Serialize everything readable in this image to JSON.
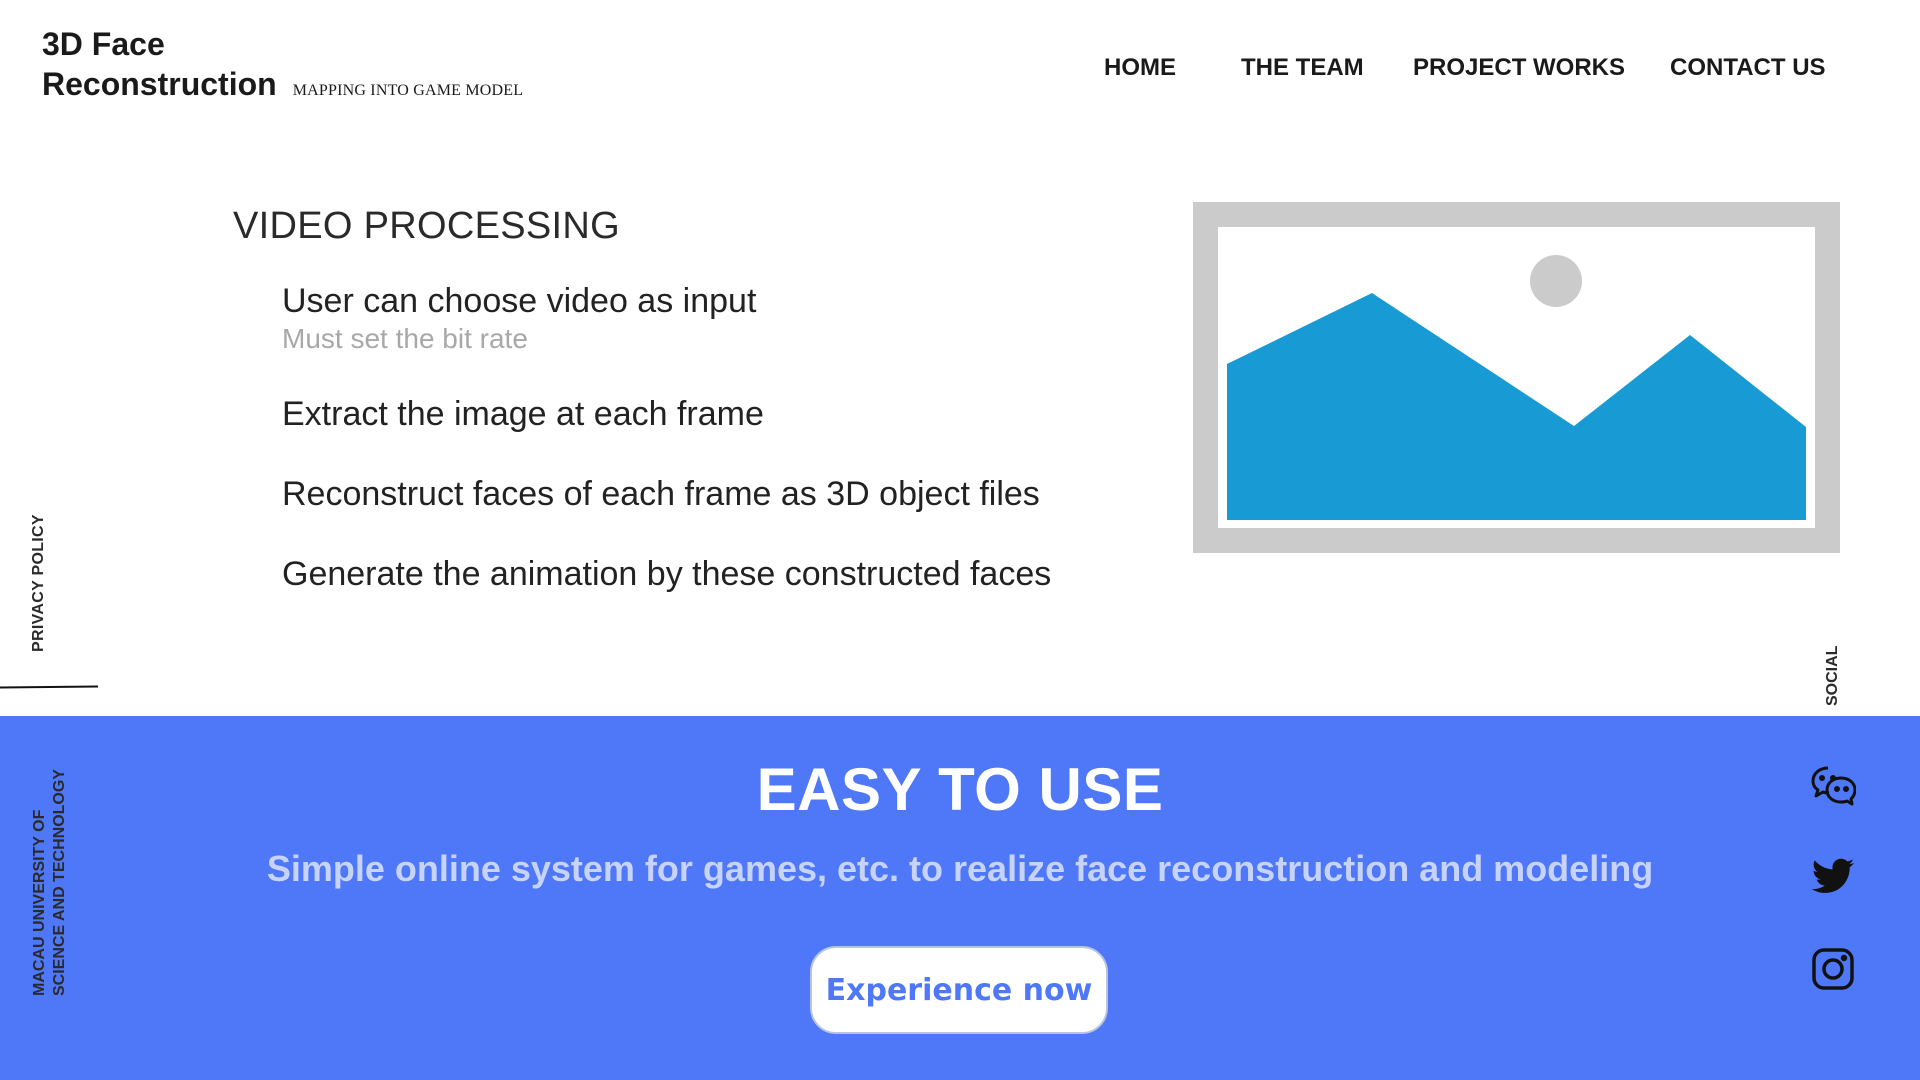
{
  "header": {
    "brand_line1": "3D Face",
    "brand_line2": "Reconstruction",
    "tagline": "MAPPING INTO GAME MODEL"
  },
  "nav": {
    "items": [
      {
        "label": "HOME"
      },
      {
        "label": "THE TEAM"
      },
      {
        "label": "PROJECT WORKS"
      },
      {
        "label": "CONTACT US"
      }
    ]
  },
  "main": {
    "section_title": "VIDEO PROCESSING",
    "items": [
      {
        "text": "User can choose video as input",
        "note": "Must set the bit rate"
      },
      {
        "text": "Extract the image at each frame"
      },
      {
        "text": "Reconstruct faces of each frame as 3D object files"
      },
      {
        "text": "Generate the animation by these constructed faces"
      }
    ],
    "image_icon": "image-placeholder-icon"
  },
  "side": {
    "privacy": "PRIVACY POLICY",
    "social": "SOCIAL",
    "university_line1": "MACAU UNIVERSITY OF",
    "university_line2": "SCIENCE AND TECHNOLOGY"
  },
  "footer": {
    "title": "EASY TO USE",
    "subtitle": "Simple online system for games, etc. to realize face reconstruction and modeling",
    "cta_label": "Experience now",
    "social_icons": [
      "wechat-icon",
      "twitter-icon",
      "instagram-icon"
    ]
  },
  "colors": {
    "footer_bg": "#4f78f8",
    "subtitle": "#c7d3fb",
    "image_frame": "#cbcbcb",
    "image_mountains": "#189ad4"
  }
}
